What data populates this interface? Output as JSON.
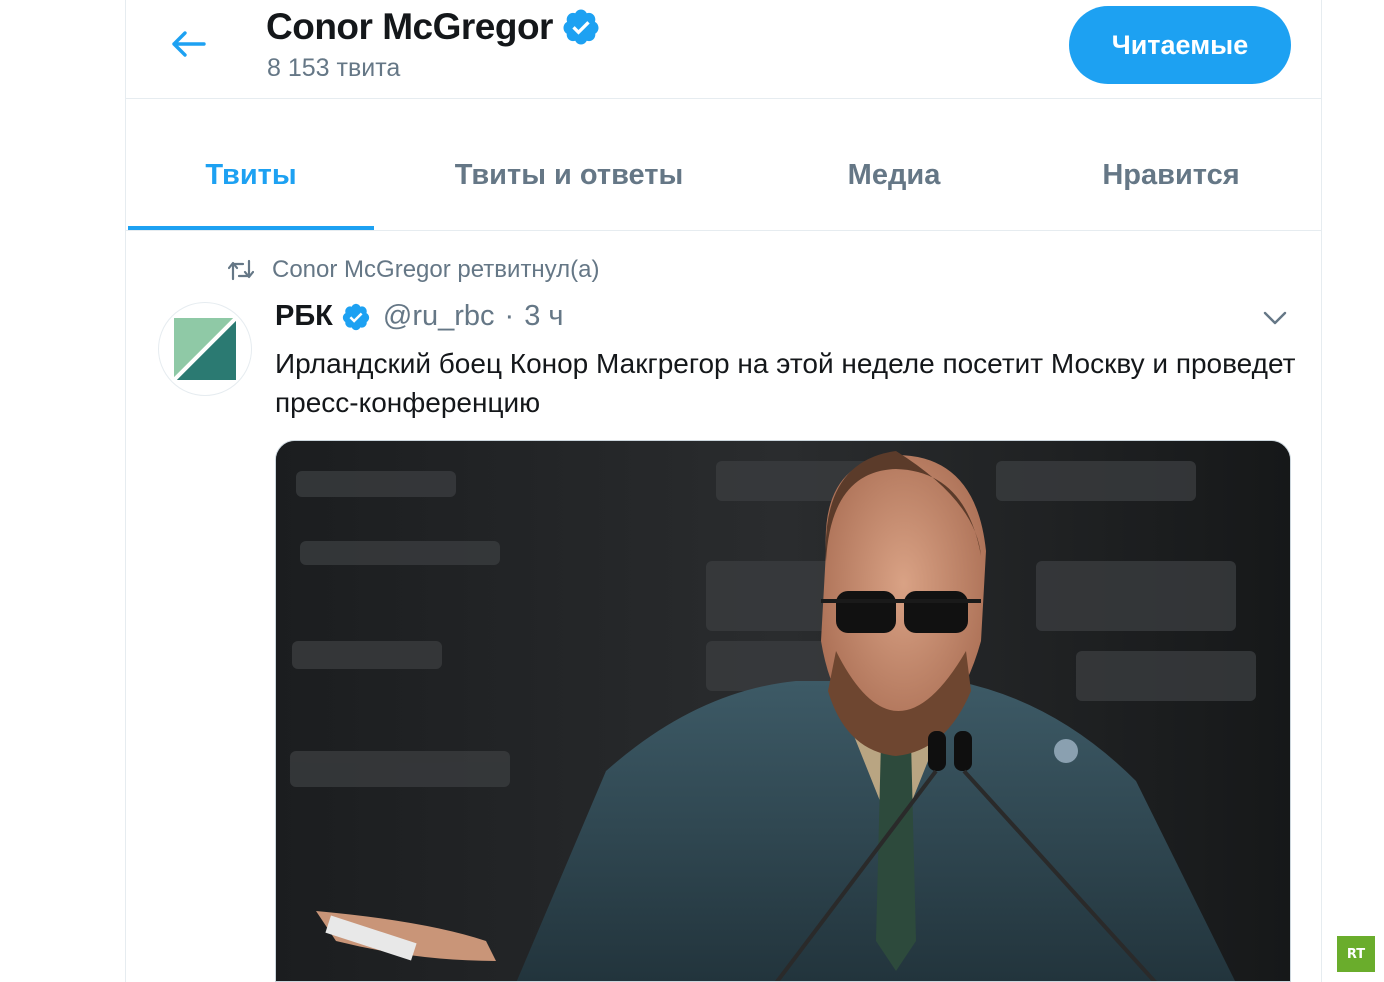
{
  "header": {
    "title": "Conor McGregor",
    "tweet_count": "8 153 твита",
    "follow_button": "Читаемые"
  },
  "tabs": [
    {
      "label": "Твиты",
      "active": true
    },
    {
      "label": "Твиты и ответы",
      "active": false
    },
    {
      "label": "Медиа",
      "active": false
    },
    {
      "label": "Нравится",
      "active": false
    }
  ],
  "tweet": {
    "retweet_label": "Conor McGregor ретвитнул(а)",
    "author_name": "РБК",
    "author_handle": "@ru_rbc",
    "separator": "·",
    "time": "3 ч",
    "text": "Ирландский боец Конор Макгрегор на этой неделе посетит Москву и проведет пресс-конференцию"
  },
  "watermark": "RT",
  "colors": {
    "accent": "#1da1f2",
    "text_primary": "#14171a",
    "text_secondary": "#657786",
    "border": "#e6ecf0",
    "rbc_green_light": "#8fc9a6",
    "rbc_green_dark": "#2b7a72"
  },
  "icons": {
    "back": "arrow-left-icon",
    "verified": "verified-badge-icon",
    "retweet": "retweet-icon",
    "caret": "chevron-down-icon"
  }
}
